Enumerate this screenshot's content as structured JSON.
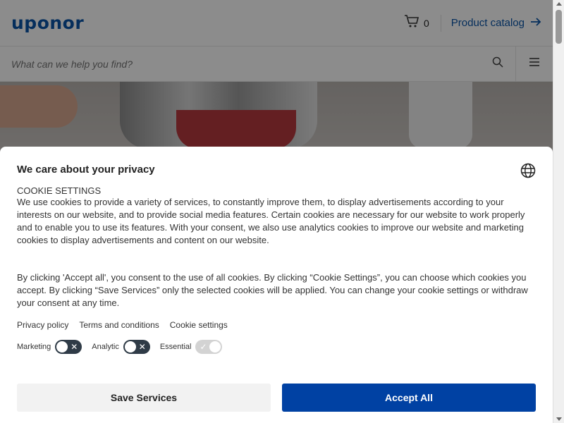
{
  "header": {
    "logo": "uponor",
    "cart_count": "0",
    "catalog_label": "Product catalog"
  },
  "search": {
    "placeholder": "What can we help you find?"
  },
  "consent": {
    "title": "We care about your privacy",
    "section_label": "COOKIE SETTINGS",
    "paragraph1": "We use cookies to provide a variety of services, to constantly improve them, to display advertisements according to your interests on our website, and to provide social media features. Certain cookies are necessary for our website to work properly and to enable you to use its features. With your consent, we also use analytics cookies to improve our website and marketing cookies to display advertisements and content on our website.",
    "paragraph2": "By clicking 'Accept all', you consent to the use of all cookies. By clicking “Cookie Settings”, you can choose which cookies you accept. By clicking “Save Services” only the selected cookies will be applied. You can change your cookie settings or withdraw your consent at any time.",
    "links": [
      "Privacy policy",
      "Terms and conditions",
      "Cookie settings"
    ],
    "toggles": [
      {
        "label": "Marketing",
        "state": "off"
      },
      {
        "label": "Analytic",
        "state": "off"
      },
      {
        "label": "Essential",
        "state": "on-disabled"
      }
    ],
    "save_label": "Save Services",
    "accept_label": "Accept All"
  },
  "colors": {
    "brand": "#0a55a8",
    "primary_button": "#0041a3"
  }
}
